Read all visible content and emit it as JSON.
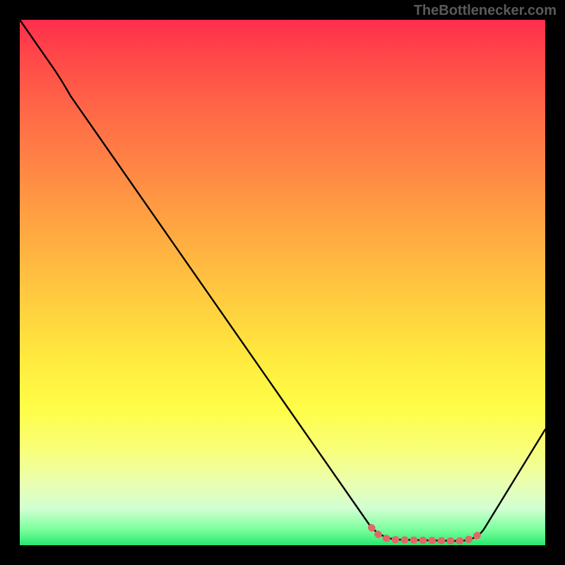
{
  "watermark": "TheBottlenecker.com",
  "colors": {
    "page_bg": "#000000",
    "curve": "#000000",
    "highlight_dots": "#e06868",
    "watermark_text": "#5a5a5a",
    "gradient_stops": [
      "#ff2e4c",
      "#ff4449",
      "#ff6a47",
      "#ff8b44",
      "#ffad41",
      "#ffce3f",
      "#ffe93e",
      "#fffd47",
      "#f8ff7a",
      "#eaffaf",
      "#d2ffd2",
      "#7bff9d",
      "#27e86f"
    ]
  },
  "chart_data": {
    "type": "line",
    "title": "",
    "xlabel": "",
    "ylabel": "",
    "xlim": [
      0,
      100
    ],
    "ylim": [
      0,
      100
    ],
    "x": [
      0,
      7,
      10,
      67,
      72,
      83,
      87,
      88,
      100
    ],
    "values": [
      100,
      90,
      86,
      4,
      1,
      1,
      1,
      3,
      22
    ],
    "annotations": [
      {
        "type": "highlight_range",
        "x_range": [
          67,
          88
        ],
        "style": "dotted",
        "color": "#e06868",
        "note": "optimal/minimum region"
      }
    ],
    "grid": false,
    "legend": false
  }
}
